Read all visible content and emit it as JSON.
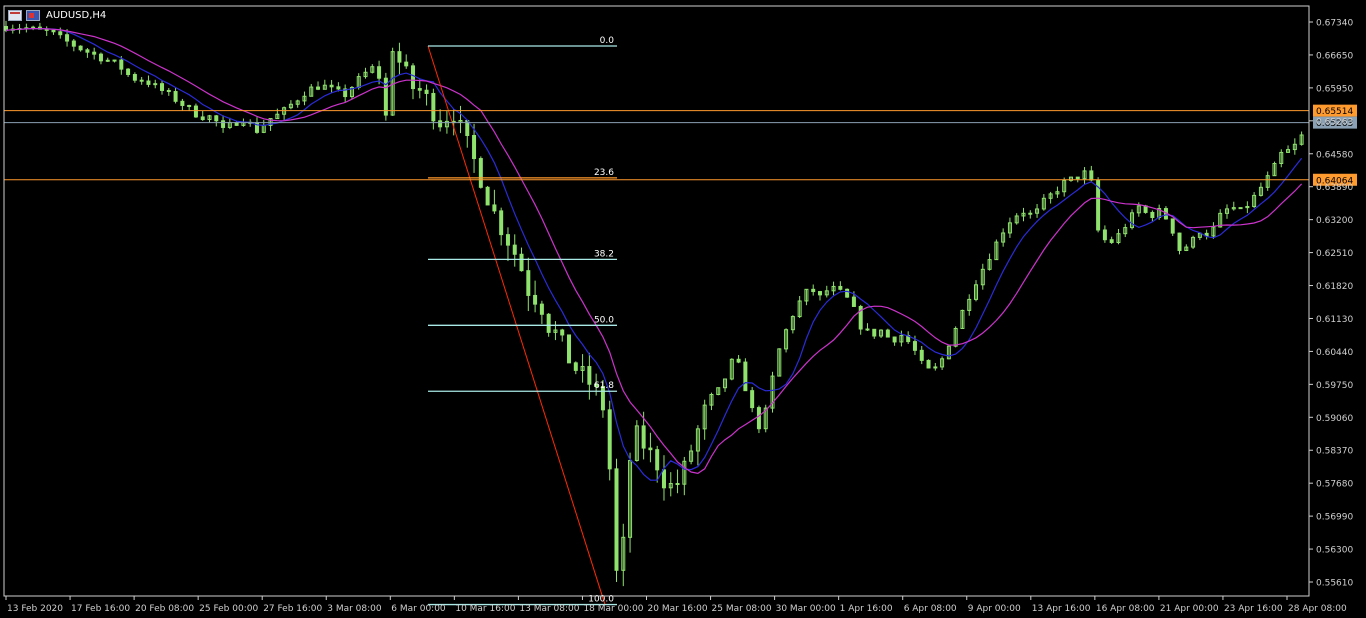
{
  "window": {
    "symbol_label": "AUDUSD,H4"
  },
  "header_icons": [
    "chart-window-icon",
    "au-flag-icon"
  ],
  "colors": {
    "background": "#000000",
    "candle": "#8fe36d",
    "axis": "#cfcfcf",
    "ma_fast": "#2b2bd9",
    "ma_slow": "#cc33cc",
    "fib_line": "#a9e9e6",
    "fib_trend": "#ff2a00",
    "hline_orange": "#ff9a2e",
    "hline_grey": "#8aa0b4"
  },
  "chart_data": {
    "type": "candlestick",
    "symbol": "AUDUSD",
    "timeframe": "H4",
    "ylim": [
      0.5533,
      0.6771
    ],
    "y_ticks": [
      "0.67340",
      "0.66650",
      "0.65950",
      "0.65263",
      "0.64580",
      "0.63890",
      "0.63200",
      "0.62510",
      "0.61820",
      "0.61130",
      "0.60440",
      "0.59750",
      "0.59060",
      "0.58370",
      "0.57680",
      "0.56990",
      "0.56300",
      "0.55610"
    ],
    "x_ticks": [
      "13 Feb 2020",
      "17 Feb 16:00",
      "20 Feb 08:00",
      "25 Feb 00:00",
      "27 Feb 16:00",
      "3 Mar 08:00",
      "6 Mar 00:00",
      "10 Mar 16:00",
      "13 Mar 08:00",
      "18 Mar 00:00",
      "20 Mar 16:00",
      "25 Mar 08:00",
      "30 Mar 00:00",
      "1 Apr 16:00",
      "6 Apr 08:00",
      "9 Apr 00:00",
      "13 Apr 16:00",
      "16 Apr 08:00",
      "21 Apr 00:00",
      "23 Apr 16:00",
      "28 Apr 08:00"
    ],
    "price_labels": [
      {
        "text": "0.65514",
        "value": 0.65514,
        "style": "orange"
      },
      {
        "text": "0.65263",
        "value": 0.65263,
        "style": "grey"
      },
      {
        "text": "0.64064",
        "value": 0.64064,
        "style": "orange"
      }
    ],
    "fibonacci": {
      "high": 0.6687,
      "low": 0.5515,
      "levels": [
        {
          "label": "0.0",
          "ratio": 0.0
        },
        {
          "label": "23.6",
          "ratio": 0.236
        },
        {
          "label": "38.2",
          "ratio": 0.382
        },
        {
          "label": "50.0",
          "ratio": 0.5
        },
        {
          "label": "61.8",
          "ratio": 0.618
        },
        {
          "label": "100.0",
          "ratio": 1.0
        }
      ]
    },
    "close_path": [
      [
        0,
        0.6728
      ],
      [
        10,
        0.6726
      ],
      [
        18,
        0.672
      ],
      [
        26,
        0.6716
      ],
      [
        34,
        0.67
      ],
      [
        42,
        0.6685
      ],
      [
        50,
        0.6672
      ],
      [
        58,
        0.666
      ],
      [
        66,
        0.6648
      ],
      [
        74,
        0.662
      ],
      [
        82,
        0.6615
      ],
      [
        90,
        0.6598
      ],
      [
        98,
        0.658
      ],
      [
        106,
        0.656
      ],
      [
        114,
        0.654
      ],
      [
        122,
        0.6538
      ],
      [
        128,
        0.651
      ],
      [
        134,
        0.6525
      ],
      [
        140,
        0.6535
      ],
      [
        148,
        0.651
      ],
      [
        156,
        0.6535
      ],
      [
        162,
        0.6545
      ],
      [
        170,
        0.657
      ],
      [
        178,
        0.6595
      ],
      [
        186,
        0.6605
      ],
      [
        194,
        0.6592
      ],
      [
        200,
        0.6585
      ],
      [
        206,
        0.661
      ],
      [
        212,
        0.663
      ],
      [
        218,
        0.6645
      ],
      [
        222,
        0.66
      ],
      [
        224,
        0.654
      ],
      [
        226,
        0.663
      ],
      [
        228,
        0.668
      ],
      [
        234,
        0.664
      ],
      [
        240,
        0.66
      ],
      [
        246,
        0.659
      ],
      [
        252,
        0.655
      ],
      [
        258,
        0.652
      ],
      [
        262,
        0.656
      ],
      [
        266,
        0.653
      ],
      [
        272,
        0.648
      ],
      [
        278,
        0.643
      ],
      [
        284,
        0.637
      ],
      [
        290,
        0.632
      ],
      [
        296,
        0.628
      ],
      [
        302,
        0.624
      ],
      [
        306,
        0.62
      ],
      [
        310,
        0.615
      ],
      [
        314,
        0.617
      ],
      [
        318,
        0.611
      ],
      [
        322,
        0.609
      ],
      [
        326,
        0.608
      ],
      [
        330,
        0.604
      ],
      [
        336,
        0.601
      ],
      [
        342,
        0.599
      ],
      [
        348,
        0.596
      ],
      [
        352,
        0.593
      ],
      [
        354,
        0.588
      ],
      [
        356,
        0.58
      ],
      [
        358,
        0.572
      ],
      [
        360,
        0.558
      ],
      [
        362,
        0.556
      ],
      [
        364,
        0.564
      ],
      [
        366,
        0.576
      ],
      [
        368,
        0.582
      ],
      [
        372,
        0.587
      ],
      [
        378,
        0.584
      ],
      [
        384,
        0.581
      ],
      [
        390,
        0.576
      ],
      [
        396,
        0.577
      ],
      [
        400,
        0.58
      ],
      [
        406,
        0.586
      ],
      [
        412,
        0.592
      ],
      [
        418,
        0.595
      ],
      [
        424,
        0.599
      ],
      [
        430,
        0.604
      ],
      [
        436,
        0.597
      ],
      [
        442,
        0.59
      ],
      [
        446,
        0.588
      ],
      [
        450,
        0.596
      ],
      [
        456,
        0.605
      ],
      [
        462,
        0.611
      ],
      [
        468,
        0.615
      ],
      [
        474,
        0.618
      ],
      [
        480,
        0.616
      ],
      [
        486,
        0.618
      ],
      [
        492,
        0.617
      ],
      [
        498,
        0.615
      ],
      [
        504,
        0.61
      ],
      [
        510,
        0.608
      ],
      [
        516,
        0.609
      ],
      [
        522,
        0.607
      ],
      [
        528,
        0.608
      ],
      [
        534,
        0.606
      ],
      [
        540,
        0.602
      ],
      [
        546,
        0.6
      ],
      [
        552,
        0.603
      ],
      [
        558,
        0.608
      ],
      [
        564,
        0.613
      ],
      [
        570,
        0.618
      ],
      [
        576,
        0.622
      ],
      [
        582,
        0.626
      ],
      [
        588,
        0.63
      ],
      [
        594,
        0.633
      ],
      [
        600,
        0.634
      ],
      [
        606,
        0.633
      ],
      [
        612,
        0.636
      ],
      [
        618,
        0.638
      ],
      [
        624,
        0.64
      ],
      [
        630,
        0.641
      ],
      [
        636,
        0.642
      ],
      [
        640,
        0.64
      ],
      [
        644,
        0.63
      ],
      [
        650,
        0.627
      ],
      [
        656,
        0.629
      ],
      [
        662,
        0.632
      ],
      [
        668,
        0.635
      ],
      [
        674,
        0.633
      ],
      [
        680,
        0.634
      ],
      [
        686,
        0.632
      ],
      [
        692,
        0.626
      ],
      [
        698,
        0.627
      ],
      [
        704,
        0.63
      ],
      [
        710,
        0.629
      ],
      [
        716,
        0.633
      ],
      [
        722,
        0.635
      ],
      [
        728,
        0.634
      ],
      [
        734,
        0.636
      ],
      [
        740,
        0.639
      ],
      [
        746,
        0.642
      ],
      [
        752,
        0.646
      ],
      [
        758,
        0.647
      ],
      [
        762,
        0.6485
      ],
      [
        766,
        0.651
      ]
    ]
  }
}
